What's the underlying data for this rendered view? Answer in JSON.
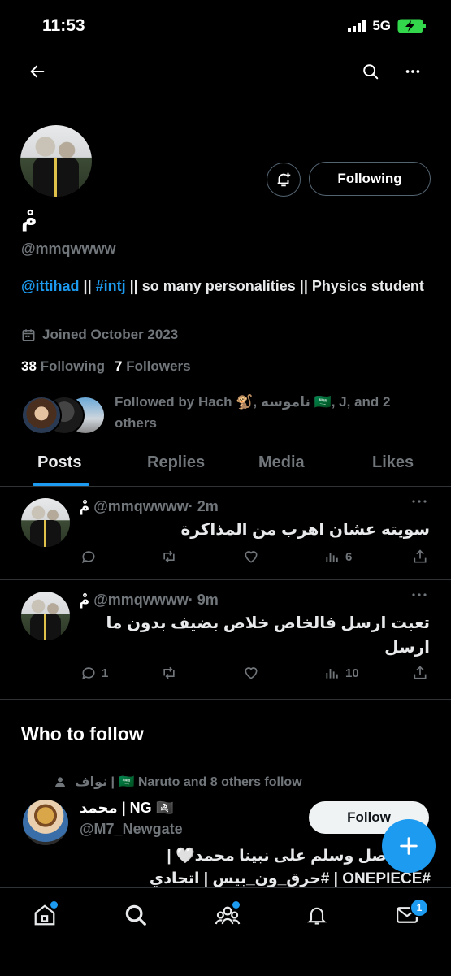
{
  "status_bar": {
    "time": "11:53",
    "network": "5G"
  },
  "profile": {
    "name": "مْ",
    "handle": "@mmqwwww",
    "bio_mention": "@ittihad",
    "bio_sep1": " || ",
    "bio_hashtag": "#intj",
    "bio_rest": " || so many personalities || Physics student",
    "joined": "Joined October 2023",
    "following_count": "38",
    "following_label": "Following",
    "followers_count": "7",
    "followers_label": "Followers",
    "followed_by": "Followed by Hach 🐒, ناموسه 🇸🇦, J, and 2 others",
    "following_button": "Following"
  },
  "tabs": [
    {
      "label": "Posts",
      "active": true
    },
    {
      "label": "Replies"
    },
    {
      "label": "Media"
    },
    {
      "label": "Likes"
    }
  ],
  "posts": [
    {
      "name": "مْ",
      "handle": "@mmqwwww",
      "time": "· 2m",
      "text": "سويته عشان اهرب من المذاكرة",
      "replies": "",
      "views": "6"
    },
    {
      "name": "مْ",
      "handle": "@mmqwwww",
      "time": "· 9m",
      "text": "تعبت ارسل فالخاص خلاص بضيف بدون ما ارسل",
      "replies": "1",
      "views": "10"
    }
  ],
  "who_to_follow": {
    "title": "Who to follow",
    "social_context": "نواف | 🇸🇦 Naruto and 8 others follow",
    "name": "محمد | NG 🏴‍☠️",
    "handle": "@M7_Newgate",
    "follow_label": "Follow",
    "bio_line1": "اللهم صل وسلم على نبينا محمد🤍 |",
    "bio_line2": "#ONEPIECE | #حرق_ون_بيس | اتحادي"
  },
  "bottom_nav": {
    "messages_badge": "1"
  },
  "icons": [
    "back-arrow-icon",
    "search-icon",
    "more-icon",
    "bell-add-icon",
    "calendar-icon",
    "reply-icon",
    "retweet-icon",
    "like-icon",
    "views-icon",
    "share-icon",
    "person-icon",
    "home-icon",
    "communities-icon",
    "notifications-icon",
    "messages-icon",
    "plus-icon"
  ]
}
